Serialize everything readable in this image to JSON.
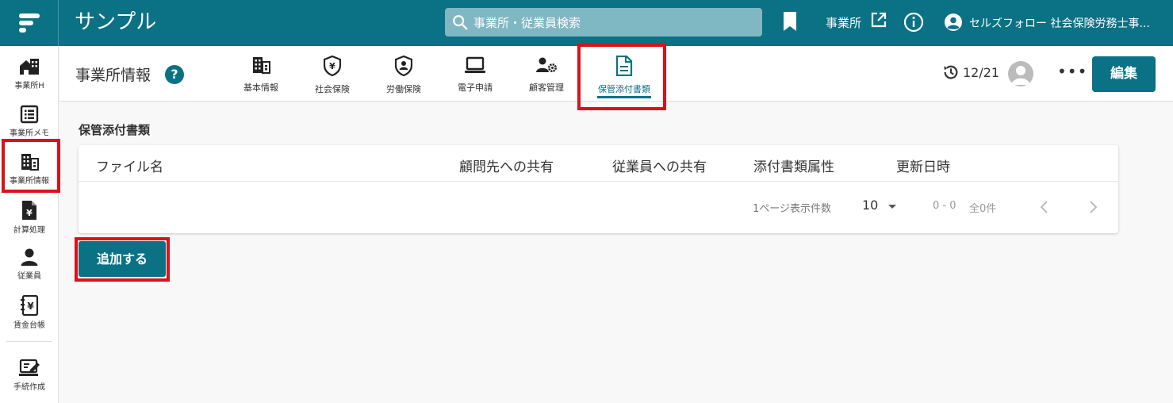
{
  "header": {
    "app_title": "サンプル",
    "search_placeholder": "事業所・従業員検索",
    "office_link": "事業所",
    "user_name": "セルズフォロー 社会保険労務士事..."
  },
  "sidebar": {
    "items": [
      {
        "label": "事業所H",
        "icon": "home-icon"
      },
      {
        "label": "事業所メモ",
        "icon": "memo-list-icon"
      },
      {
        "label": "事業所情報",
        "icon": "office-building-icon"
      },
      {
        "label": "計算処理",
        "icon": "yen-document-icon"
      },
      {
        "label": "従業員",
        "icon": "person-icon"
      },
      {
        "label": "賃金台帳",
        "icon": "ledger-yen-icon"
      },
      {
        "label": "手続作成",
        "icon": "procedure-edit-icon"
      }
    ],
    "active": "事業所情報"
  },
  "subheader": {
    "title": "事業所情報",
    "help": "?",
    "tabs": [
      {
        "label": "基本情報",
        "icon": "building-icon"
      },
      {
        "label": "社会保険",
        "icon": "shield-yen-icon"
      },
      {
        "label": "労働保険",
        "icon": "shield-person-icon"
      },
      {
        "label": "電子申請",
        "icon": "laptop-icon"
      },
      {
        "label": "顧客管理",
        "icon": "person-gear-icon"
      },
      {
        "label": "保管添付書類",
        "icon": "document-icon"
      }
    ],
    "active_tab": "保管添付書類",
    "history_date": "12/21",
    "more": "•••",
    "edit_label": "編集"
  },
  "main": {
    "section_title": "保管添付書類",
    "columns": [
      "ファイル名",
      "顧問先への共有",
      "従業員への共有",
      "添付書類属性",
      "更新日時"
    ],
    "rows": [],
    "pagination": {
      "per_page_label": "1ページ表示件数",
      "per_page_value": "10",
      "range": "0 - 0",
      "total": "全0件"
    },
    "add_button": "追加する"
  },
  "colors": {
    "brand": "#0b7185",
    "highlight": "#d9111a"
  }
}
